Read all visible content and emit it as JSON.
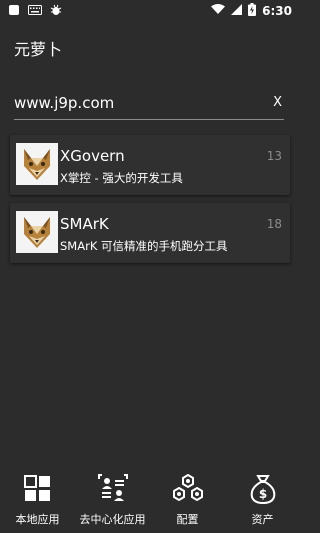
{
  "status": {
    "time": "6:30"
  },
  "app": {
    "title": "元萝卜"
  },
  "search": {
    "value": "www.j9p.com",
    "clear_label": "X"
  },
  "items": [
    {
      "name": "XGovern",
      "desc": "X掌控 - 强大的开发工具",
      "count": "13",
      "icon": "wolf-logo-icon"
    },
    {
      "name": "SMArK",
      "desc": "SMArK 可信精准的手机跑分工具",
      "count": "18",
      "icon": "wolf-logo-icon"
    }
  ],
  "nav": [
    {
      "label": "本地应用",
      "icon": "grid-apps-icon"
    },
    {
      "label": "去中心化应用",
      "icon": "people-network-icon"
    },
    {
      "label": "配置",
      "icon": "hexagon-nodes-icon"
    },
    {
      "label": "资产",
      "icon": "money-bag-icon"
    }
  ]
}
